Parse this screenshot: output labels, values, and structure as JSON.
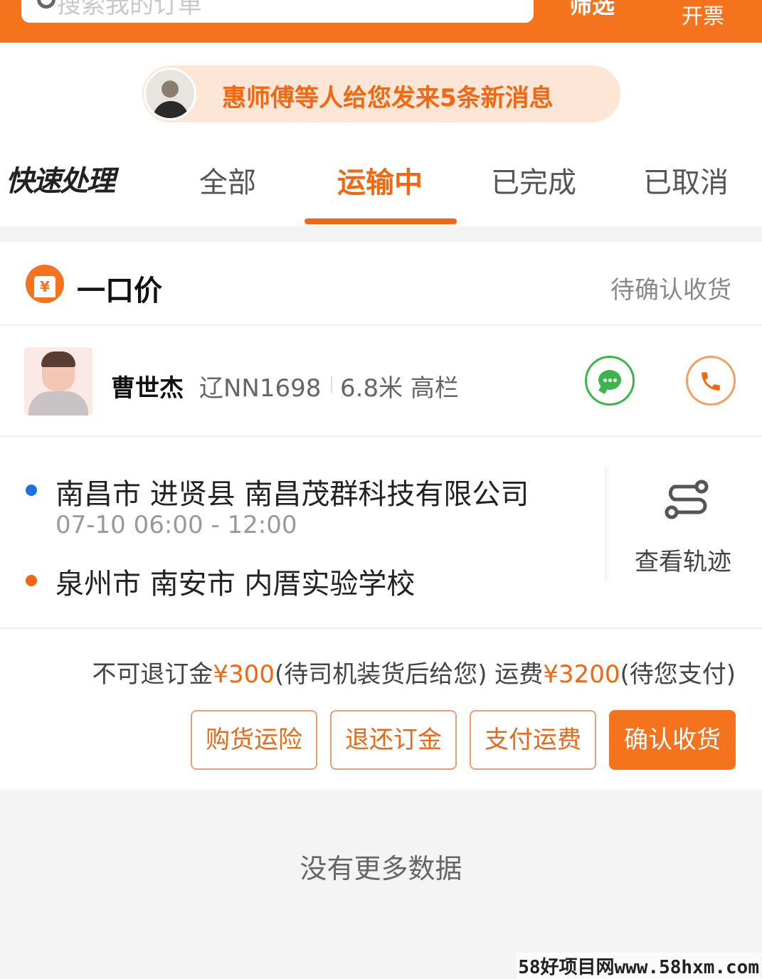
{
  "header": {
    "search_placeholder": "搜索我的订单",
    "filter_label": "筛选",
    "invoice_label": "开票"
  },
  "notice": {
    "text": "惠师傅等人给您发来5条新消息"
  },
  "tabs": {
    "quick": "快速处理",
    "items": [
      {
        "label": "全部"
      },
      {
        "label": "运输中"
      },
      {
        "label": "已完成"
      },
      {
        "label": "已取消"
      }
    ],
    "active_index": 1
  },
  "order": {
    "type_title": "一口价",
    "type_icon_glyph": "¥",
    "status": "待确认收货",
    "driver": {
      "name": "曹世杰",
      "plate": "辽NN1698",
      "truck": "6.8米 高栏"
    },
    "route": {
      "from_address": "南昌市 进贤县 南昌茂群科技有限公司",
      "from_time": "07-10 06:00 - 12:00",
      "to_address": "泉州市 南安市 内厝实验学校",
      "track_label": "查看轨迹"
    },
    "fees": {
      "deposit_prefix": "不可退订金",
      "deposit_amount": "¥300",
      "deposit_note": "(待司机装货后给您) 运费",
      "freight_amount": "¥3200",
      "freight_note": "(待您支付)"
    },
    "actions": {
      "insurance": "购货运险",
      "refund_deposit": "退还订金",
      "pay_freight": "支付运费",
      "confirm_receipt": "确认收货"
    }
  },
  "footer": {
    "no_more": "没有更多数据",
    "watermark": "58好项目网www.58hxm.com"
  },
  "colors": {
    "accent": "#f5731c",
    "wechat_green": "#3cb44b",
    "origin_blue": "#1f6fe5"
  },
  "icons": [
    "search-icon",
    "price-tag-icon",
    "chat-icon",
    "phone-icon",
    "route-track-icon"
  ]
}
